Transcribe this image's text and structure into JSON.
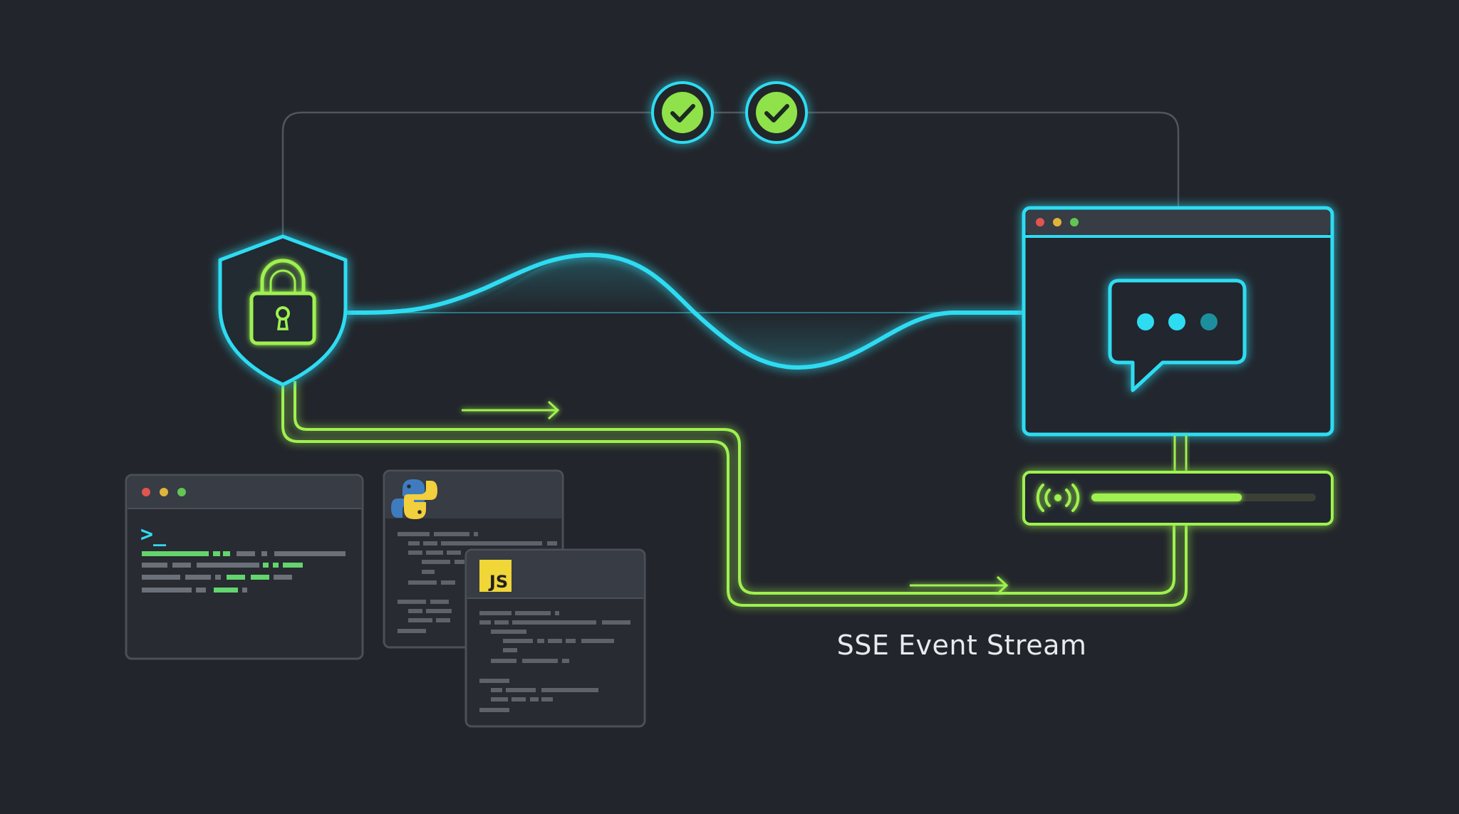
{
  "caption": "SSE Event Stream",
  "js_badge": "JS",
  "terminal_prompt": ">_",
  "stream_progress": 0.67,
  "checks": [
    {
      "icon": "check-icon",
      "state": "done"
    },
    {
      "icon": "check-icon",
      "state": "done"
    }
  ],
  "icons": {
    "shield": "shield-lock-icon",
    "chat": "chat-bubble-icon",
    "broadcast": "broadcast-icon",
    "python": "python-logo-icon",
    "javascript": "javascript-logo-icon"
  },
  "colors": {
    "background": "#22252b",
    "cyan": "#2fdcf2",
    "green": "#9ef14f",
    "panel": "#2b2f37",
    "panel_border": "#4b5058",
    "titlebar": "#383c44",
    "dot_red": "#e0554e",
    "dot_yellow": "#e0b43a",
    "dot_green": "#62c554"
  }
}
